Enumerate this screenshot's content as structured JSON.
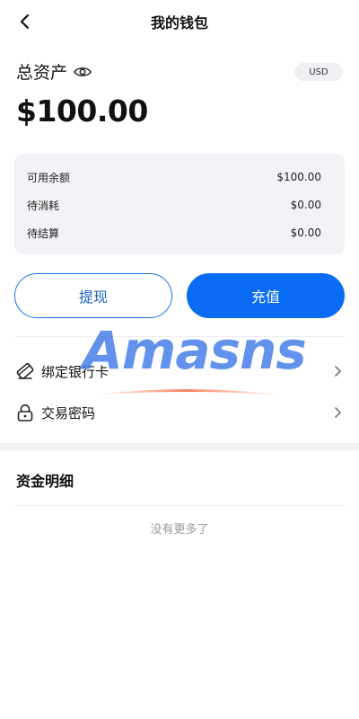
{
  "header": {
    "title": "我的钱包"
  },
  "assets": {
    "label": "总资产",
    "amount": "$100.00",
    "currency": "USD"
  },
  "balances": [
    {
      "label": "可用余额",
      "value": "$100.00"
    },
    {
      "label": "待消耗",
      "value": "$0.00"
    },
    {
      "label": "待结算",
      "value": "$0.00"
    }
  ],
  "actions": {
    "withdraw": "提现",
    "recharge": "充值"
  },
  "menu": [
    {
      "label": "绑定银行卡",
      "icon": "bank-card-icon"
    },
    {
      "label": "交易密码",
      "icon": "lock-icon"
    }
  ],
  "details": {
    "title": "资金明细",
    "empty": "没有更多了"
  },
  "watermark": {
    "text": "Amasns"
  },
  "colors": {
    "primary": "#0a6cf5",
    "card_bg": "#f2f3f6",
    "muted_text": "#9a9a9a"
  }
}
